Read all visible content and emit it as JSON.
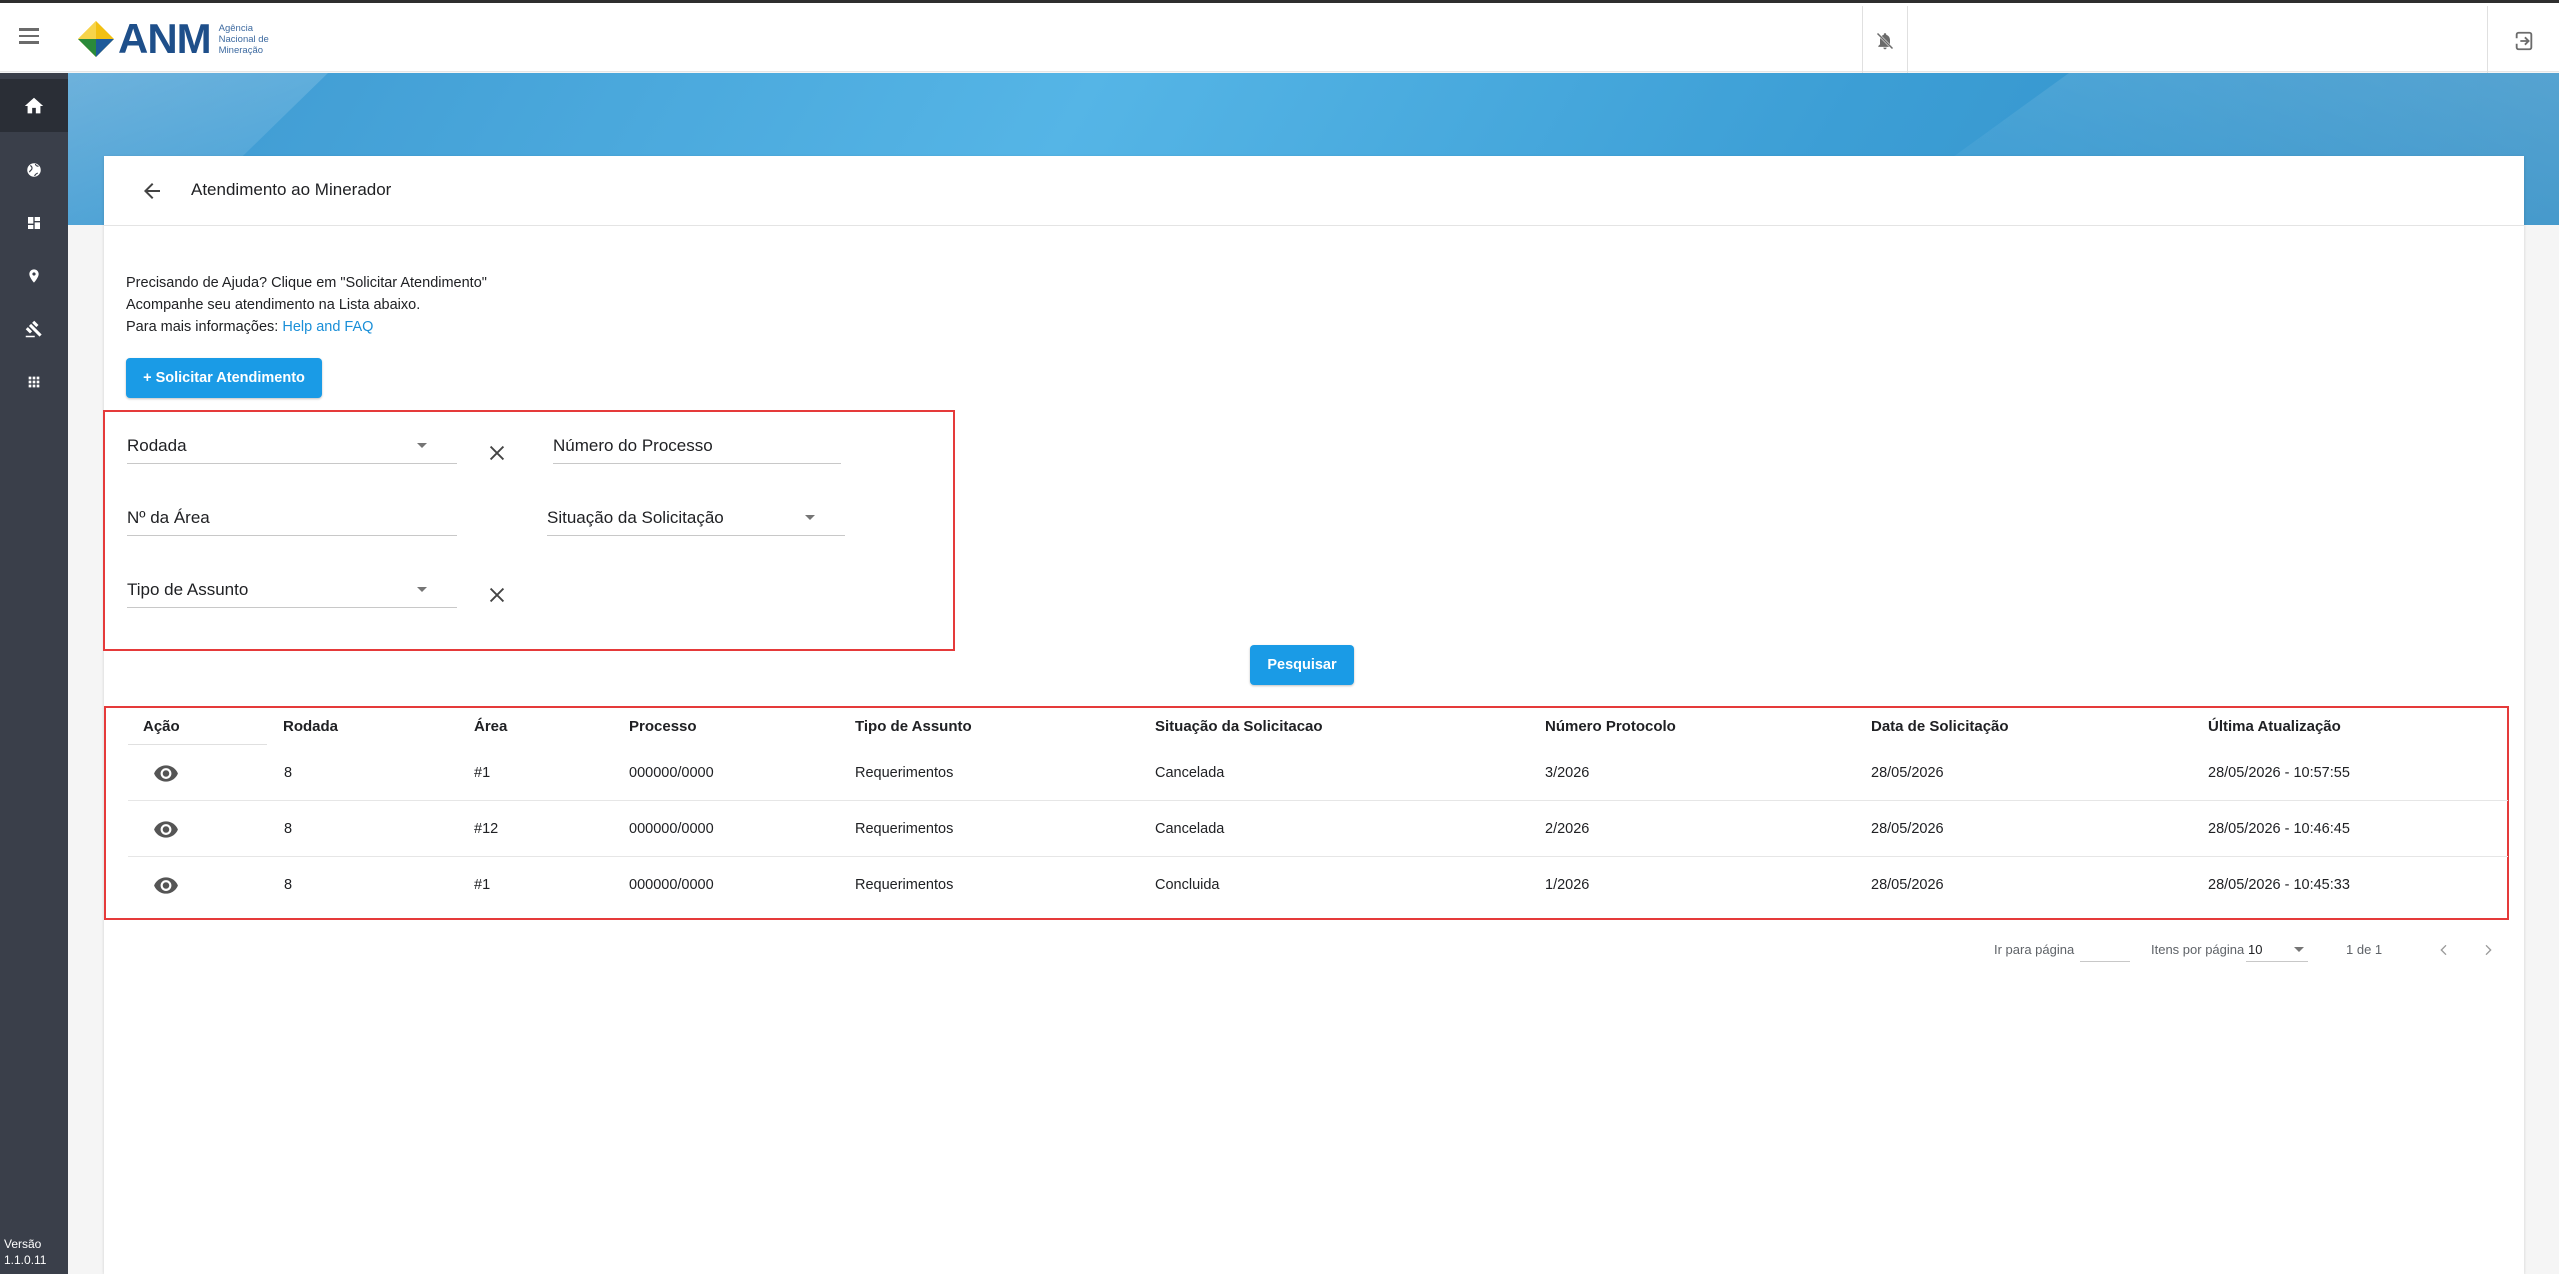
{
  "header": {
    "logo_text": "ANM",
    "logo_subtitle": "Agência Nacional de Mineração"
  },
  "sidebar": {
    "items": [
      {
        "icon": "home-icon"
      },
      {
        "icon": "globe-icon"
      },
      {
        "icon": "dashboard-icon"
      },
      {
        "icon": "location-pin-icon"
      },
      {
        "icon": "gavel-icon"
      },
      {
        "icon": "apps-grid-icon"
      }
    ],
    "version_label": "Versão",
    "version_number": "1.1.0.11"
  },
  "page": {
    "title": "Atendimento ao Minerador",
    "help_line1": "Precisando de Ajuda? Clique em \"Solicitar Atendimento\"",
    "help_line2": "Acompanhe seu atendimento na Lista abaixo.",
    "help_line3_prefix": "Para mais informações: ",
    "help_link": "Help and FAQ",
    "request_button": "+ Solicitar Atendimento",
    "search_button": "Pesquisar"
  },
  "filters": {
    "rodada": "Rodada",
    "numero_processo": "Número do Processo",
    "numero_area": "Nº da Área",
    "situacao": "Situação da Solicitação",
    "tipo_assunto": "Tipo de Assunto"
  },
  "table": {
    "headers": [
      "Ação",
      "Rodada",
      "Área",
      "Processo",
      "Tipo de Assunto",
      "Situação da Solicitacao",
      "Número Protocolo",
      "Data de Solicitação",
      "Última Atualização"
    ],
    "rows": [
      {
        "rodada": "8",
        "area": "#1",
        "processo": "000000/0000",
        "tipo": "Requerimentos",
        "situacao": "Cancelada",
        "protocolo": "3/2026",
        "data": "28/05/2026",
        "atualizacao": "28/05/2026 - 10:57:55"
      },
      {
        "rodada": "8",
        "area": "#12",
        "processo": "000000/0000",
        "tipo": "Requerimentos",
        "situacao": "Cancelada",
        "protocolo": "2/2026",
        "data": "28/05/2026",
        "atualizacao": "28/05/2026 - 10:46:45"
      },
      {
        "rodada": "8",
        "area": "#1",
        "processo": "000000/0000",
        "tipo": "Requerimentos",
        "situacao": "Concluida",
        "protocolo": "1/2026",
        "data": "28/05/2026",
        "atualizacao": "28/05/2026 - 10:45:33"
      }
    ]
  },
  "pagination": {
    "goto_label": "Ir para página",
    "per_page_label": "Itens por página",
    "per_page_value": "10",
    "range": "1 de 1"
  },
  "colors": {
    "primary": "#1a9be6",
    "highlight_border": "#e53a3a",
    "sidebar_bg": "#3a3f4a",
    "link": "#1a8fd8"
  }
}
